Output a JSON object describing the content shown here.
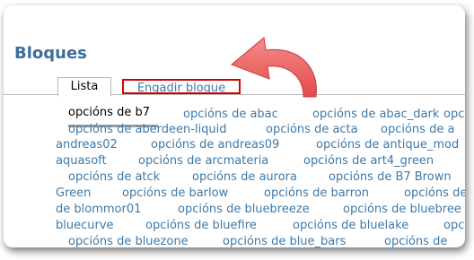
{
  "page": {
    "title": "Bloques"
  },
  "tabs": {
    "list_label": "Lista",
    "add_label": "Engadir bloque"
  },
  "colors": {
    "title": "#3d6d9c",
    "link": "#3d79aa",
    "highlight_box": "#d40000",
    "arrow_fill": "#f26a6a"
  },
  "options": [
    "opcións de b7",
    "opcións de abac",
    "opcións de abac_dark",
    "opc",
    "opcións de aberdeen-liquid",
    "opcións de acta",
    "opcións de a",
    "andreas02",
    "opcións de andreas09",
    "opcións de antique_mod",
    "aquasoft",
    "opcións de arcmateria",
    "opcións de art4_green",
    "opcións de atck",
    "opcións de aurora",
    "opcións de B7 Brown",
    "Green",
    "opcións de barlow",
    "opcións de barron",
    "opcións de",
    "de blommor01",
    "opcións de bluebreeze",
    "opcións de bluebree",
    "bluecurve",
    "opcións de bluefire",
    "opcións de bluelake",
    "opc",
    "opcións de bluezone",
    "opcións de blue_bars",
    "opcións de"
  ]
}
